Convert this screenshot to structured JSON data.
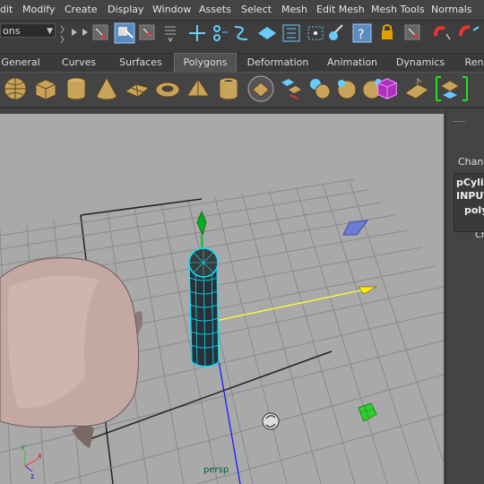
{
  "menubar": {
    "items": [
      "dit",
      "Modify",
      "Create",
      "Display",
      "Window",
      "Assets",
      "Select",
      "Mesh",
      "Edit Mesh",
      "Mesh Tools",
      "Normals",
      ""
    ]
  },
  "statusline": {
    "mode_selector": "ons"
  },
  "shelf_tabs": {
    "items": [
      "General",
      "Curves",
      "Surfaces",
      "Polygons",
      "Deformation",
      "Animation",
      "Dynamics",
      "Ren"
    ],
    "active": "Polygons"
  },
  "shelf_icons": [
    "poly-sphere-icon",
    "poly-cube-icon",
    "poly-cylinder-icon",
    "poly-cone-icon",
    "poly-plane-icon",
    "poly-torus-icon",
    "poly-pyramid-icon",
    "poly-pipe-icon",
    "poly-smooth-icon",
    "poly-extract-icon",
    "poly-combine-icon",
    "poly-separate-icon",
    "poly-mirror-icon",
    "poly-crease-icon",
    "poly-triangulate-icon",
    "poly-uv-editor-icon"
  ],
  "viewport": {
    "camera_label": "persp",
    "axis_x": "x",
    "axis_y": "y",
    "axis_z": "z"
  },
  "channel_box": {
    "header": "Ch",
    "label": "Chann",
    "object_name": "pCylir",
    "inputs_label": "INPUT",
    "input_node": "poly"
  },
  "colors": {
    "viewport_bg": "#a9a9a9",
    "grid": "#8c8c8c",
    "selection": "#00e5ff",
    "manip_y": "#00b020",
    "manip_x": "#e0e000",
    "head": "#c4a9a2"
  }
}
